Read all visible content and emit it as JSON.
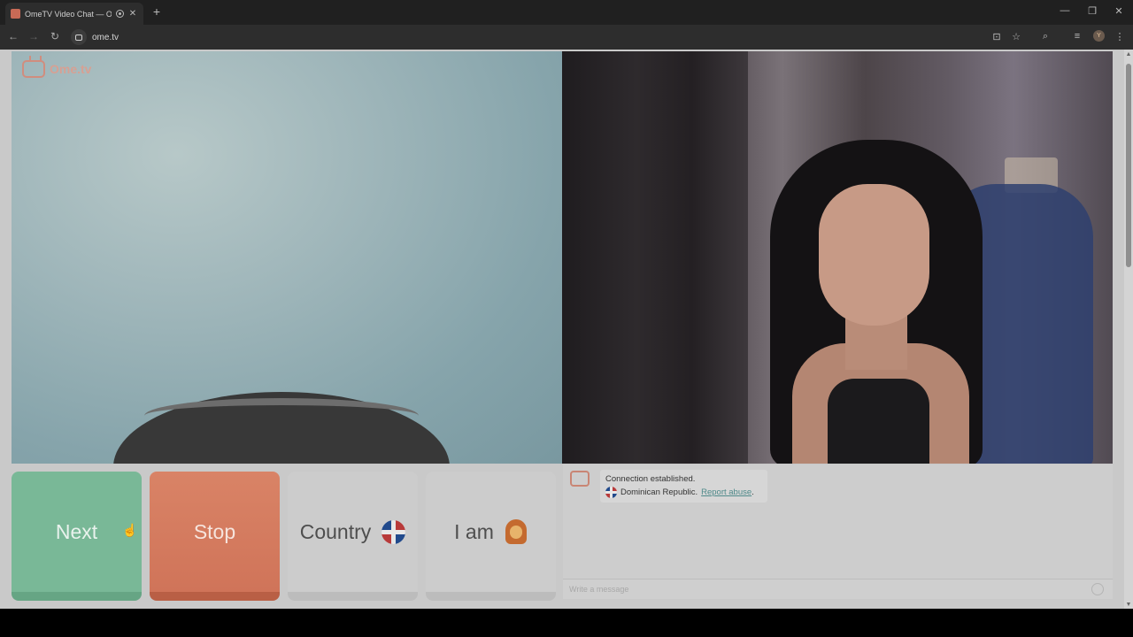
{
  "browser": {
    "tab_title": "OmeTV Video Chat — Ome.tv",
    "new_tab": "+",
    "tab_close": "✕",
    "url": "ome.tv",
    "avatar_letter": "Y",
    "window": {
      "minimize": "—",
      "restore": "❐",
      "close": "✕"
    }
  },
  "page": {
    "logo_text": "Ome.tv",
    "buttons": {
      "next": "Next",
      "stop": "Stop",
      "country": "Country",
      "iam": "I am"
    },
    "chat": {
      "status": "Connection established.",
      "country": "Dominican Republic.",
      "report": "Report abuse",
      "report_suffix": ".",
      "input_placeholder": "Write a message"
    }
  },
  "colors": {
    "next": "#79b897",
    "stop": "#d07459",
    "accent_link": "#4f8a8a"
  },
  "icons": [
    "ometv-logo-icon",
    "dominican-flag-icon",
    "person-emoji-icon",
    "smiley-icon",
    "mouse-cursor-icon"
  ]
}
